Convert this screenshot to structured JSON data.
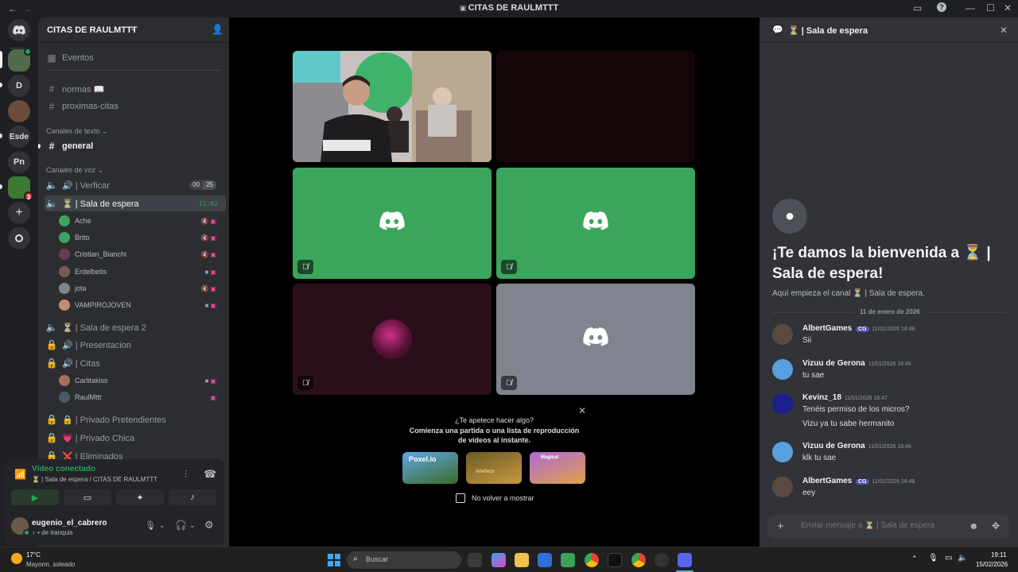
{
  "window": {
    "title": "CITAS DE RAULMTTT",
    "back": "←",
    "forward": "→"
  },
  "server_rail": [
    {
      "label": "",
      "icon": "discord-home-icon"
    },
    {
      "label": "",
      "icon": "server-avatar"
    },
    {
      "label": "D"
    },
    {
      "label": ""
    },
    {
      "label": "Esde"
    },
    {
      "label": "Pn"
    },
    {
      "label": "",
      "badge": "3"
    },
    {
      "label": "+"
    },
    {
      "label": ""
    }
  ],
  "guild": {
    "name": "CITAS DE RAULMTTT",
    "events": "Eventos",
    "top_channels": [
      "normas 📖",
      "proximas-citas"
    ],
    "text_category": "Canales de texto",
    "text_channels": [
      "general"
    ],
    "voice_category": "Canales de voz",
    "voice_channels": {
      "verificar": {
        "label": "🔊 | Verficar",
        "count": "00",
        "limit": "25"
      },
      "sala": {
        "label": "⏳ | Sala de espera",
        "time": "11:02"
      },
      "sala2": "⏳ | Sala de espera 2",
      "presentacion": "🔊 | Presentacion",
      "citas": "🔊 | Citas",
      "privado_pretendientes": "🔒 | Privado Pretendientes",
      "privado_chica": "💗 | Privado Chica",
      "eliminados": "❌ | Eliminados"
    },
    "sala_members": [
      "Ache",
      "Brito",
      "Cristian_Bianchi",
      "Erdelbetis",
      "jota",
      "VAMPIROJOVEN"
    ],
    "citas_members": [
      "Carlitakiss",
      "RaulMttt"
    ]
  },
  "voice_panel": {
    "status": "Vídeo conectado",
    "location": "⏳ | Sala de espera / CITAS DE RAULMTTT"
  },
  "user": {
    "name": "eugenio_el_cabrero",
    "status": "de tranquis"
  },
  "promo": {
    "question": "¿Te apetece hacer algo?",
    "line1": "Comienza una partida o una lista de reproducción",
    "line2": "de vídeos al instante.",
    "games": [
      "Poxel.io",
      "Artefacts",
      "Magical"
    ],
    "checkbox": "No volver a mostrar"
  },
  "chat": {
    "header": "⏳ | Sala de espera",
    "welcome_line1": "¡Te damos la bienvenida a ⏳ |",
    "welcome_line2": "Sala de espera!",
    "welcome_sub": "Aquí empieza el canal ⏳ | Sala de espera.",
    "date_divider": "11 de enero de 2026",
    "messages": [
      {
        "author": "AlbertGames",
        "tag": "CG",
        "time": "11/01/2026 16:46",
        "lines": [
          "Sii"
        ]
      },
      {
        "author": "Vizuu de Gerona",
        "time": "11/01/2026 16:46",
        "lines": [
          "tu sae"
        ]
      },
      {
        "author": "Kevinz_18",
        "time": "11/01/2026 16:47",
        "lines": [
          "Tenéis permiso de los micros?",
          "Vizu ya tu sabe hermanito"
        ]
      },
      {
        "author": "Vizuu de Gerona",
        "time": "11/01/2026 16:48",
        "lines": [
          "klk tu sae"
        ]
      },
      {
        "author": "AlbertGames",
        "tag": "CG",
        "time": "11/01/2026 16:48",
        "lines": [
          "eey"
        ]
      }
    ],
    "composer_placeholder": "Enviar mensaje a ⏳ | Sala de espera"
  },
  "taskbar": {
    "weather_temp": "17°C",
    "weather_desc": "Mayorm. soleado",
    "search": "Buscar",
    "clock_time": "19:11",
    "clock_date": "15/02/2026"
  },
  "colors": {
    "green": "#23a55a",
    "tile_green": "#3ba55c",
    "blurple": "#5865f2",
    "tile_grey": "#80848e",
    "tile_dark": "#2a0f1a"
  }
}
